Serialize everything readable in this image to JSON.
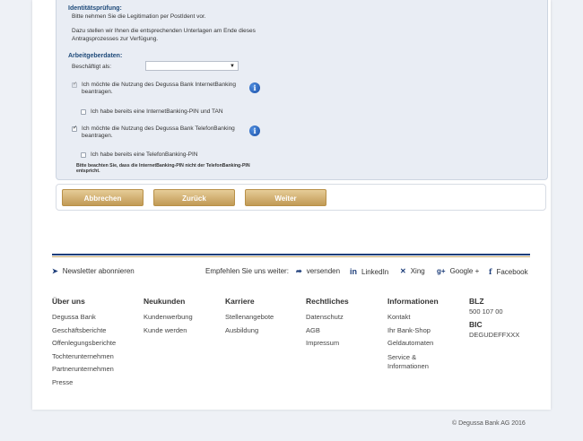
{
  "form": {
    "identity_title": "Identitätsprüfung:",
    "identity_text1": "Bitte nehmen Sie die Legitimation per PostIdent vor.",
    "identity_text2a": "Dazu stellen wir Ihnen die entsprechenden Unterlagen am Ende dieses",
    "identity_text2b": "Antragsprozesses zur Verfügung.",
    "employer_title": "Arbeitgeberdaten:",
    "employed_label": "Beschäftigt als:",
    "employed_value": "",
    "internetbanking_label_a": "Ich möchte die Nutzung des Degussa Bank InternetBanking",
    "internetbanking_label_b": "beantragen.",
    "internet_pin_label": "Ich habe bereits eine InternetBanking-PIN und TAN",
    "telefonbanking_label_a": "Ich möchte die Nutzung des Degussa Bank TelefonBanking",
    "telefonbanking_label_b": "beantragen.",
    "telefon_pin_label": "Ich habe bereits eine TelefonBanking-PIN",
    "note_a": "Bitte beachten Sie, dass die InternetBanking-PIN nicht der TelefonBanking-PIN",
    "note_b": "entspricht.",
    "info_glyph": "i"
  },
  "buttons": {
    "cancel": "Abbrechen",
    "back": "Zurück",
    "next": "Weiter"
  },
  "social": {
    "newsletter": "Newsletter abonnieren",
    "recommend": "Empfehlen Sie uns weiter:",
    "send": "versenden",
    "linkedin": "LinkedIn",
    "xing": "Xing",
    "google": "Google +",
    "facebook": "Facebook",
    "icons": {
      "newsletter": "paper-plane-icon",
      "send": "share-arrow-icon",
      "linkedin": "linkedin-icon",
      "xing": "xing-icon",
      "google": "google-plus-icon",
      "facebook": "facebook-icon"
    }
  },
  "footer": {
    "ueber": {
      "title": "Über uns",
      "items": [
        "Degussa Bank",
        "Geschäftsberichte",
        "Offenlegungsberichte",
        "Tochterunternehmen",
        "Partnerunternehmen",
        "Presse"
      ]
    },
    "neukunden": {
      "title": "Neukunden",
      "items": [
        "Kundenwerbung",
        "Kunde werden"
      ]
    },
    "karriere": {
      "title": "Karriere",
      "items": [
        "Stellenangebote",
        "Ausbildung"
      ]
    },
    "rechtliches": {
      "title": "Rechtliches",
      "items": [
        "Datenschutz",
        "AGB",
        "Impressum"
      ]
    },
    "informationen": {
      "title": "Informationen",
      "items": [
        "Kontakt",
        "Ihr Bank-Shop",
        "Geldautomaten",
        "Service &",
        "Informationen"
      ]
    },
    "blz_label": "BLZ",
    "blz_value": "500 107 00",
    "bic_label": "BIC",
    "bic_value": "DEGUDEFFXXX"
  },
  "copyright": "© Degussa Bank AG 2016",
  "colors": {
    "navy": "#1e3e7a",
    "gold": "#c8a96a",
    "button": "#c19a55"
  }
}
